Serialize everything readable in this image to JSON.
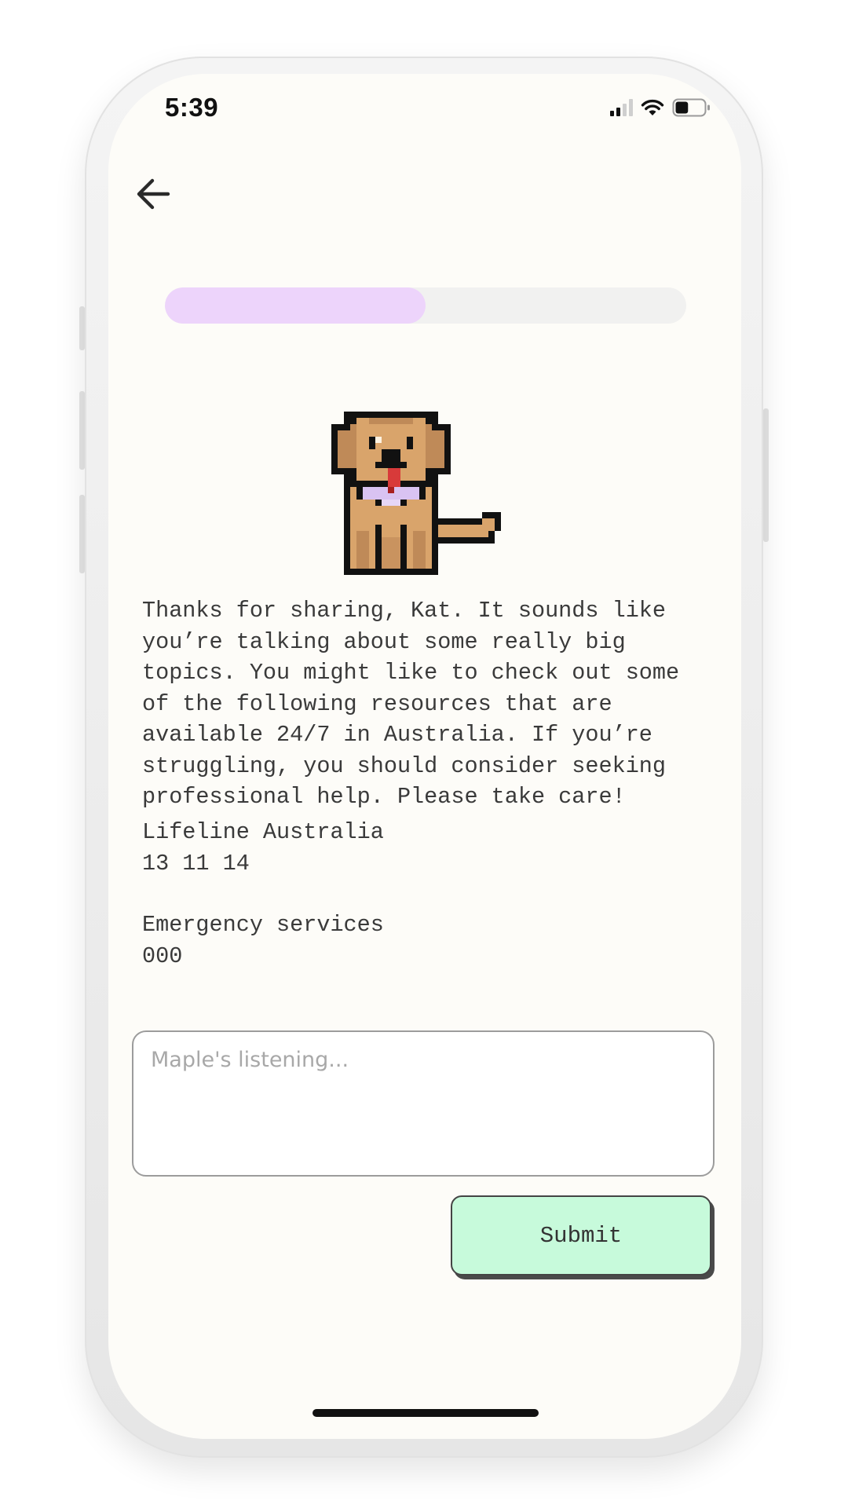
{
  "status_bar": {
    "time": "5:39",
    "battery_level": 0.45,
    "icons": [
      "cellular-signal-icon",
      "wifi-icon",
      "battery-icon"
    ]
  },
  "nav": {
    "back_icon": "arrow-left-icon"
  },
  "progress": {
    "value": 0.5,
    "fill_color": "#edd4fb",
    "track_color": "#f1f1f0"
  },
  "mascot": {
    "icon": "pixel-dog-icon"
  },
  "message": {
    "text": "Thanks for sharing, Kat. It sounds like\nyou’re talking about some really big\ntopics. You might like to check out some\nof the following resources that are\navailable 24/7 in Australia. If you’re\nstruggling, you should consider seeking\nprofessional help. Please take care!"
  },
  "resources": [
    {
      "name": "Lifeline Australia",
      "number": "13 11 14"
    },
    {
      "name": "Emergency services",
      "number": "000"
    }
  ],
  "input": {
    "value": "",
    "placeholder": "Maple's listening..."
  },
  "submit": {
    "label": "Submit",
    "color": "#c7fadb"
  },
  "colors": {
    "screen_bg": "#fdfcf8",
    "text": "#3a3a3a"
  }
}
